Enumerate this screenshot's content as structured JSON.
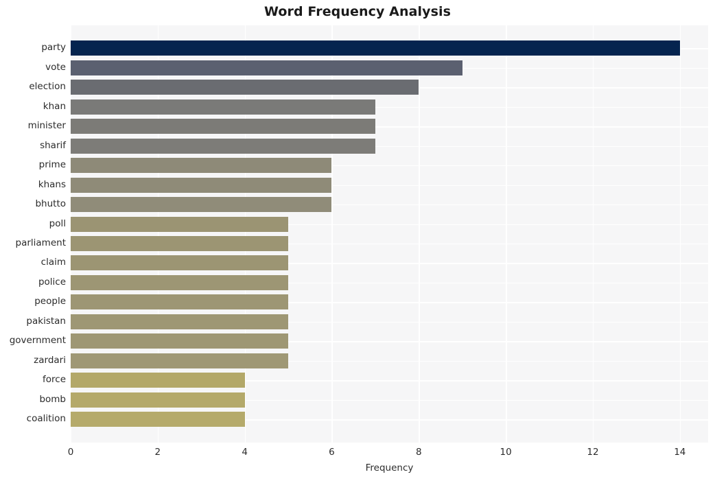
{
  "chart_data": {
    "type": "bar",
    "orientation": "horizontal",
    "title": "Word Frequency Analysis",
    "xlabel": "Frequency",
    "ylabel": "",
    "categories": [
      "party",
      "vote",
      "election",
      "khan",
      "minister",
      "sharif",
      "prime",
      "khans",
      "bhutto",
      "poll",
      "parliament",
      "claim",
      "police",
      "people",
      "pakistan",
      "government",
      "zardari",
      "force",
      "bomb",
      "coalition"
    ],
    "values": [
      14,
      9,
      8,
      7,
      7,
      7,
      6,
      6,
      6,
      5,
      5,
      5,
      5,
      5,
      5,
      5,
      5,
      4,
      4,
      4
    ],
    "bar_colors": [
      "#05244f",
      "#5b6070",
      "#6a6c71",
      "#7a7a78",
      "#7c7b77",
      "#7d7c78",
      "#8e8a78",
      "#8f8b78",
      "#908c79",
      "#9b9473",
      "#9c9573",
      "#9c9573",
      "#9d9674",
      "#9d9674",
      "#9e9774",
      "#9e9774",
      "#9f9875",
      "#b3a869",
      "#b4a96a",
      "#b5aa6b"
    ],
    "xlim": [
      0,
      14.65
    ],
    "xticks": [
      0,
      2,
      4,
      6,
      8,
      10,
      12,
      14
    ],
    "xticklabels": [
      "0",
      "2",
      "4",
      "6",
      "8",
      "10",
      "12",
      "14"
    ],
    "grid": true,
    "grid_color": "#ffffff",
    "plot_background": "#f6f6f7",
    "figure_background": "#ffffff",
    "legend": null
  }
}
